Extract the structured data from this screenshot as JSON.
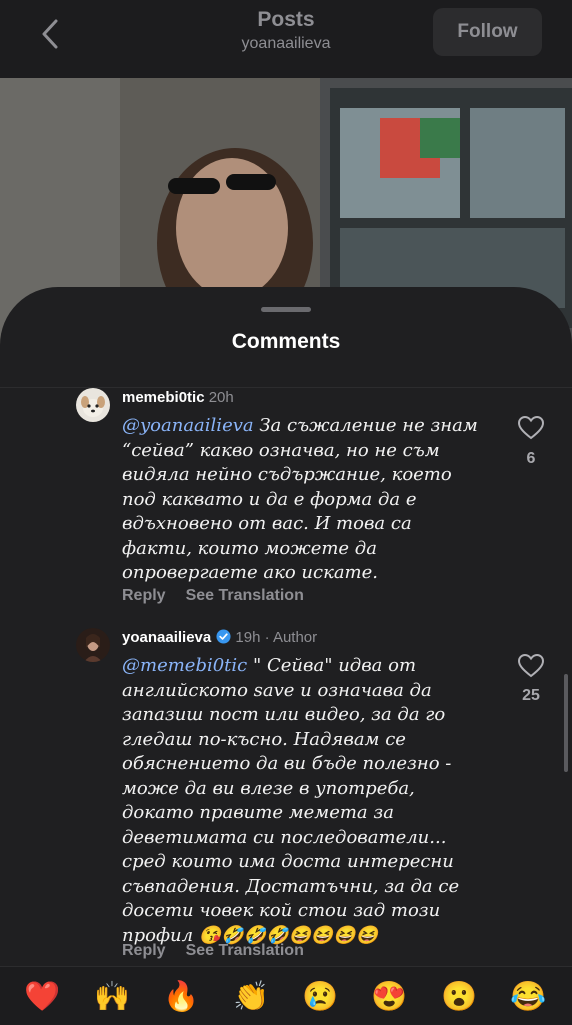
{
  "header": {
    "title": "Posts",
    "subtitle": "yoanaailieva",
    "follow_label": "Follow"
  },
  "sheet": {
    "title": "Comments"
  },
  "comments": [
    {
      "username": "memebi0tic",
      "time": "20h",
      "mention": "@yoanaailieva",
      "lines": [
        " За съжаление не знам",
        "“сейва” какво означва, но не съм",
        "видяла нейно съдържание, което",
        "под каквато и да е форма да е",
        "вдъхновено от вас. И това са",
        "факти, които можете да",
        "опровергаете ако искате."
      ],
      "likes": "6",
      "reply_label": "Reply",
      "translate_label": "See Translation"
    },
    {
      "username": "yoanaailieva",
      "time": "19h",
      "author_tag": "· Author",
      "mention": "@memebi0tic",
      "lines": [
        " \" Сейва\" идва от",
        "английското save и означава да",
        "запазиш пост или видео, за да го",
        "гледаш по-късно. Надявам се",
        "обяснението да ви бъде полезно -",
        "може да ви влезе в употреба,",
        "докато правите мемета за",
        "деветимата си последователи...",
        "сред които има доста интересни",
        "съвпадения. Достатъчни, за да се",
        "досети човек кой стои зад този",
        "профил 😘🤣🤣🤣😆😆😆😆"
      ],
      "likes": "25",
      "reply_label": "Reply",
      "translate_label": "See Translation"
    }
  ],
  "reactions": [
    "❤️",
    "🙌",
    "🔥",
    "👏",
    "😢",
    "😍",
    "😮",
    "😂"
  ],
  "icons": [
    "chevron-left-icon",
    "heart-outline-icon",
    "verified-badge-icon"
  ],
  "colors": {
    "mention": "#8ab4f8",
    "verified": "#3897f0",
    "sheet": "#1f1f21"
  }
}
